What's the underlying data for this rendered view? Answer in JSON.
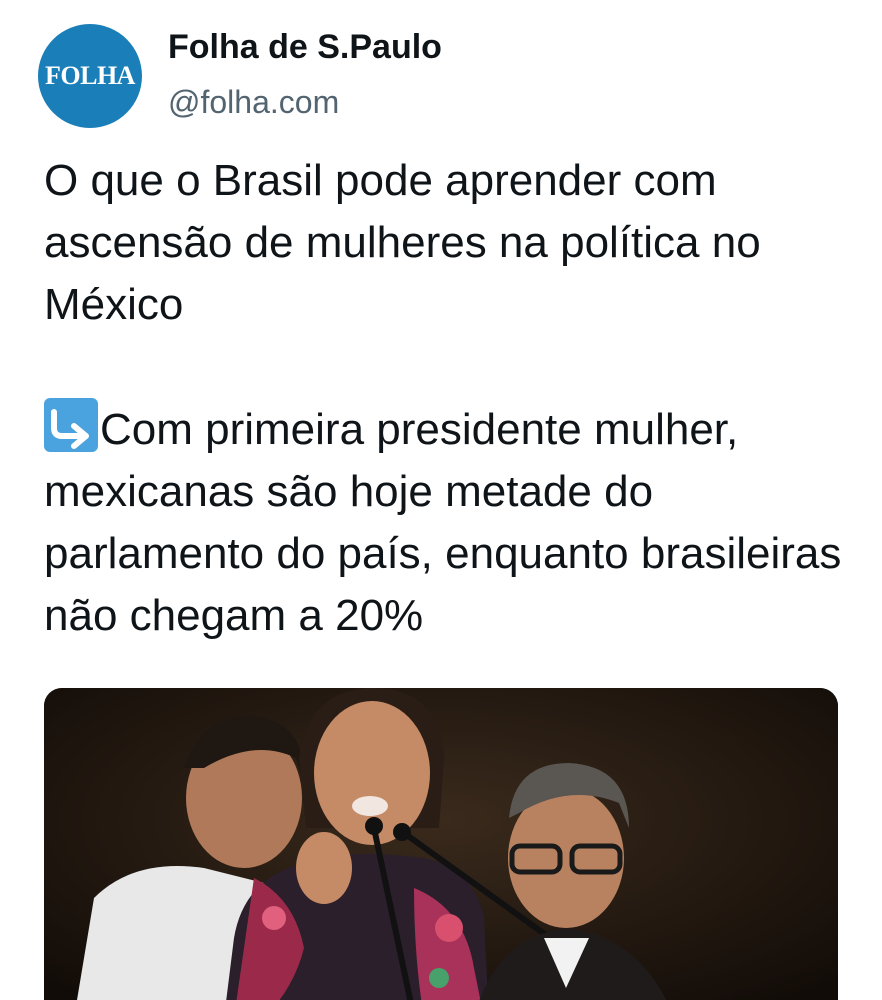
{
  "account": {
    "avatar_text": "FOLHA",
    "display_name": "Folha de S.Paulo",
    "handle": "@folha.com"
  },
  "tweet": {
    "headline": "O que o Brasil pode aprender com ascensão de mulheres na política no México",
    "arrow_icon": "right-arrow-curving-up-icon",
    "body": "Com primeira presidente mulher, mexicanas são hoje metade do parlamento do país, enquanto brasileiras não chegam a 20%"
  },
  "media": {
    "type": "photo"
  },
  "colors": {
    "avatar_bg": "#1a7fb8",
    "handle": "#536471",
    "text": "#0f1419"
  }
}
